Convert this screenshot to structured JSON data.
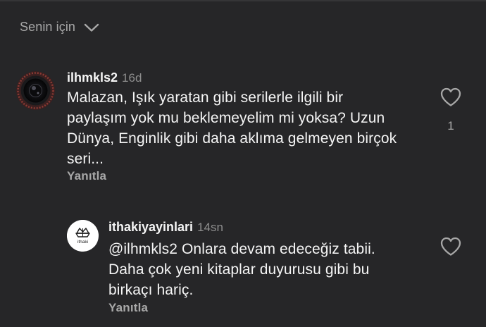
{
  "sort": {
    "label": "Senin için",
    "icon": "chevron-down-icon"
  },
  "comments": [
    {
      "username": "ilhmkls2",
      "time": "16d",
      "text": "Malazan, Işık yaratan gibi serilerle ilgili bir\npaylaşım yok mu beklemeyelim mi yoksa? Uzun\nDünya, Enginlik gibi daha aklıma gelmeyen birçok\nseri...",
      "reply_label": "Yanıtla",
      "likes": "1"
    },
    {
      "username": "ithakiyayinlari",
      "time": "14sn",
      "text": "@ilhmkls2 Onlara devam edeceğiz tabii.\nDaha çok yeni kitaplar duyurusu gibi bu\nbirkaçı hariç.",
      "reply_label": "Yanıtla",
      "avatar_logo_text": "ithaki"
    }
  ],
  "colors": {
    "background": "#262628",
    "text_primary": "#f5f5f5",
    "text_secondary": "#a8a8a8",
    "timestamp": "#8e8e8e"
  }
}
